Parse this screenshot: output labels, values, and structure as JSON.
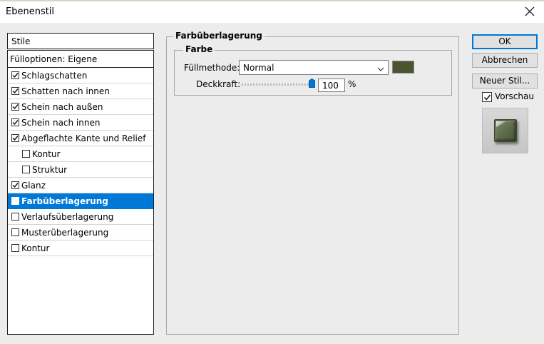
{
  "window": {
    "title": "Ebenenstil"
  },
  "styles_panel": {
    "header": "Stile",
    "fill_options": "Fülloptionen: Eigene",
    "items": [
      {
        "label": "Schlagschatten",
        "checked": true,
        "indent": false,
        "selected": false
      },
      {
        "label": "Schatten nach innen",
        "checked": true,
        "indent": false,
        "selected": false
      },
      {
        "label": "Schein nach außen",
        "checked": true,
        "indent": false,
        "selected": false
      },
      {
        "label": "Schein nach innen",
        "checked": true,
        "indent": false,
        "selected": false
      },
      {
        "label": "Abgeflachte Kante und Relief",
        "checked": true,
        "indent": false,
        "selected": false
      },
      {
        "label": "Kontur",
        "checked": false,
        "indent": true,
        "selected": false
      },
      {
        "label": "Struktur",
        "checked": false,
        "indent": true,
        "selected": false
      },
      {
        "label": "Glanz",
        "checked": true,
        "indent": false,
        "selected": false
      },
      {
        "label": "Farbüberlagerung",
        "checked": true,
        "indent": false,
        "selected": true
      },
      {
        "label": "Verlaufsüberlagerung",
        "checked": false,
        "indent": false,
        "selected": false
      },
      {
        "label": "Musterüberlagerung",
        "checked": false,
        "indent": false,
        "selected": false
      },
      {
        "label": "Kontur",
        "checked": false,
        "indent": false,
        "selected": false
      }
    ]
  },
  "color_overlay": {
    "group_title": "Farbüberlagerung",
    "subgroup_title": "Farbe",
    "blend_mode_label": "Füllmethode:",
    "blend_mode_value": "Normal",
    "overlay_color": "#4a5430",
    "opacity_label": "Deckkraft:",
    "opacity_value": "100",
    "opacity_unit": "%",
    "opacity_fraction": 1.0
  },
  "buttons": {
    "ok": "OK",
    "cancel": "Abbrechen",
    "new_style": "Neuer Stil..."
  },
  "preview": {
    "label": "Vorschau",
    "checked": true
  },
  "colors": {
    "selection": "#0078d7",
    "accent": "#0078d7"
  }
}
